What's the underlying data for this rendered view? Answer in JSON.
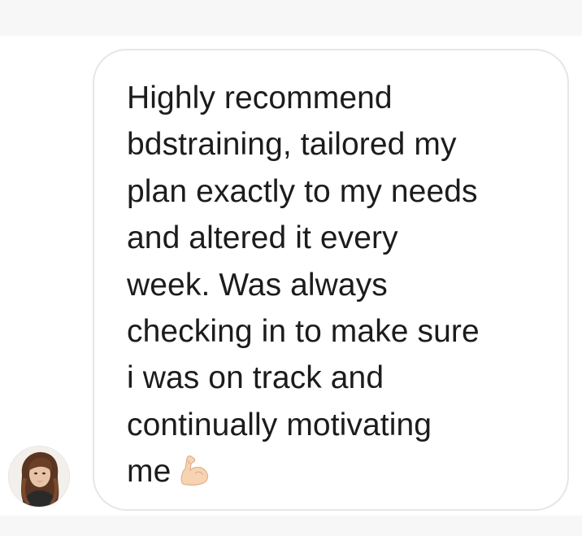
{
  "message": {
    "text": "Highly recommend\nbdstraining, tailored my\nplan exactly to my needs\nand altered it every\nweek. Was always\nchecking in to make sure\ni was on track and\ncontinually motivating\nme",
    "emoji": "flexed-biceps-icon"
  },
  "sender": {
    "avatar": "avatar-photo"
  },
  "colors": {
    "bubble_border": "#e6e6e6",
    "text": "#1c1c1c",
    "background": "#ffffff"
  }
}
